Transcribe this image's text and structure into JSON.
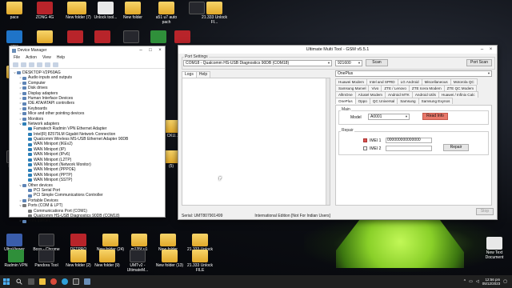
{
  "desktop": {
    "icons": [
      {
        "label": "pace",
        "style": "folder"
      },
      {
        "label": "ZONG 4G",
        "style": "red"
      },
      {
        "label": "",
        "style": "folder"
      },
      {
        "label": "New folder (7)",
        "style": "folder"
      },
      {
        "label": "Unlock tool...",
        "style": "doc"
      },
      {
        "label": "New folder",
        "style": "folder"
      },
      {
        "label": "a51 u7 auto pach",
        "style": "folder"
      },
      {
        "label": "",
        "style": "dark"
      },
      {
        "label": "21.333 Unlock FI...",
        "style": "folder"
      },
      {
        "label": "ome",
        "style": "blue"
      },
      {
        "label": "",
        "style": "folder"
      },
      {
        "label": "",
        "style": "red"
      },
      {
        "label": "",
        "style": "red"
      },
      {
        "label": "",
        "style": "dark"
      },
      {
        "label": "",
        "style": "green"
      },
      {
        "label": "",
        "style": "red"
      },
      {
        "label": "",
        "style": "folder"
      },
      {
        "label": "Mediat",
        "style": "dark"
      },
      {
        "label": "(5)",
        "style": "folder"
      },
      {
        "label": "CKU...",
        "style": "folder"
      },
      {
        "label": "UltraViewer",
        "style": "app"
      },
      {
        "label": "Boss - Chrome",
        "style": "dark"
      },
      {
        "label": "DFTPRO",
        "style": "red"
      },
      {
        "label": "New folder (24)",
        "style": "folder"
      },
      {
        "label": "m135f u1",
        "style": "folder"
      },
      {
        "label": "New folder",
        "style": "folder"
      },
      {
        "label": "21.333 Unlock FILE",
        "style": "folder"
      },
      {
        "label": "Radmin VPN",
        "style": "green"
      },
      {
        "label": "Pandora Tool",
        "style": "dark"
      },
      {
        "label": "New folder (2)",
        "style": "folder"
      },
      {
        "label": "New folder (9)",
        "style": "folder"
      },
      {
        "label": "UMTv2 - UltimateM...",
        "style": "dark"
      },
      {
        "label": "New folder (13)",
        "style": "folder"
      },
      {
        "label": "21.333 Unlock FILE",
        "style": "folder"
      },
      {
        "label": "New Text Document",
        "style": "doc"
      }
    ]
  },
  "device_manager": {
    "title": "Device Manager",
    "menu": [
      "File",
      "Action",
      "View",
      "Help"
    ],
    "tree": [
      {
        "label": "DESKTOP-V2P60AG",
        "level": 0,
        "twisty": "v",
        "icon": "pc"
      },
      {
        "label": "Audio inputs and outputs",
        "level": 1,
        "twisty": ">",
        "icon": "dev"
      },
      {
        "label": "Computer",
        "level": 1,
        "twisty": ">",
        "icon": "dev"
      },
      {
        "label": "Disk drives",
        "level": 1,
        "twisty": ">",
        "icon": "dev"
      },
      {
        "label": "Display adapters",
        "level": 1,
        "twisty": ">",
        "icon": "dev"
      },
      {
        "label": "Human Interface Devices",
        "level": 1,
        "twisty": ">",
        "icon": "dev"
      },
      {
        "label": "IDE ATA/ATAPI controllers",
        "level": 1,
        "twisty": ">",
        "icon": "dev"
      },
      {
        "label": "Keyboards",
        "level": 1,
        "twisty": ">",
        "icon": "dev"
      },
      {
        "label": "Mice and other pointing devices",
        "level": 1,
        "twisty": ">",
        "icon": "dev"
      },
      {
        "label": "Monitors",
        "level": 1,
        "twisty": ">",
        "icon": "dev"
      },
      {
        "label": "Network adapters",
        "level": 1,
        "twisty": "v",
        "icon": "net"
      },
      {
        "label": "Famatech Radmin VPN Ethernet Adapter",
        "level": 2,
        "twisty": "",
        "icon": "net"
      },
      {
        "label": "Intel(R) 82579LM Gigabit Network Connection",
        "level": 2,
        "twisty": "",
        "icon": "net"
      },
      {
        "label": "Qualcomm Wireless MS-USB Ethernet Adapter 90DB",
        "level": 2,
        "twisty": "",
        "icon": "net"
      },
      {
        "label": "WAN Miniport (IKEv2)",
        "level": 2,
        "twisty": "",
        "icon": "net"
      },
      {
        "label": "WAN Miniport (IP)",
        "level": 2,
        "twisty": "",
        "icon": "net"
      },
      {
        "label": "WAN Miniport (IPv6)",
        "level": 2,
        "twisty": "",
        "icon": "net"
      },
      {
        "label": "WAN Miniport (L2TP)",
        "level": 2,
        "twisty": "",
        "icon": "net"
      },
      {
        "label": "WAN Miniport (Network Monitor)",
        "level": 2,
        "twisty": "",
        "icon": "net"
      },
      {
        "label": "WAN Miniport (PPPOE)",
        "level": 2,
        "twisty": "",
        "icon": "net"
      },
      {
        "label": "WAN Miniport (PPTP)",
        "level": 2,
        "twisty": "",
        "icon": "net"
      },
      {
        "label": "WAN Miniport (SSTP)",
        "level": 2,
        "twisty": "",
        "icon": "net"
      },
      {
        "label": "Other devices",
        "level": 1,
        "twisty": "v",
        "icon": "dev"
      },
      {
        "label": "PCI Serial Port",
        "level": 2,
        "twisty": "",
        "icon": "dev"
      },
      {
        "label": "PCI Simple Communications Controller",
        "level": 2,
        "twisty": "",
        "icon": "dev"
      },
      {
        "label": "Portable Devices",
        "level": 1,
        "twisty": ">",
        "icon": "dev"
      },
      {
        "label": "Ports (COM & LPT)",
        "level": 1,
        "twisty": "v",
        "icon": "port"
      },
      {
        "label": "Communications Port (COM1)",
        "level": 2,
        "twisty": "",
        "icon": "port"
      },
      {
        "label": "Qualcomm HS-USB Diagnostics 90DB (COM18)",
        "level": 2,
        "twisty": "",
        "icon": "port"
      },
      {
        "label": "Print queues",
        "level": 1,
        "twisty": ">",
        "icon": "dev"
      }
    ]
  },
  "umt": {
    "title": "Ultimate Multi Tool - GSM v5.5.1",
    "port_settings_label": "Port Settings",
    "port_value": "COM18 - Qualcomm HS-USB Diagnostics 90DB (COM18)",
    "baud_value": "921600",
    "scan_label": "Scan",
    "port_scan_label": "Port Scan",
    "log_tab": "Logs",
    "help_tab": "Help",
    "brand_value": "OnePlus",
    "tab_rows": [
      [
        "Huawei Modem",
        "Intel and SPRD",
        "LG Android",
        "Miscellaneous",
        "Motorola QC"
      ],
      [
        "Samsung Marvel",
        "Vivo",
        "ZTE / Lenovo",
        "ZTE Icera Modem",
        "ZTE QC Modem"
      ],
      [
        "AllInOne",
        "Alcatel Modem",
        "Android MTK",
        "Android Utils",
        "Huawei / Infinix Calc"
      ],
      [
        "OnePlus",
        "Oppo",
        "QC Universal",
        "Samsung",
        "Samsung Exynos"
      ]
    ],
    "active_tab": "OnePlus",
    "main_label": "Main",
    "model_label": "Model",
    "model_value": "A0001",
    "read_info_label": "Read Info",
    "repair_label": "Repair",
    "imei1_label": "IMEI 1",
    "imei1_value": "000000000000000",
    "imei2_label": "IMEI 2",
    "imei2_value": "",
    "repair_button_label": "Repair",
    "stop_label": "Stop",
    "serial_text": "Serial: UMT807901499",
    "edition_text": "International Edition [Not For Indian Users]"
  },
  "taskbar": {
    "start_icon": "windows-logo-icon",
    "clock_time": "12:56 pm",
    "clock_date": "05/12/2023"
  }
}
